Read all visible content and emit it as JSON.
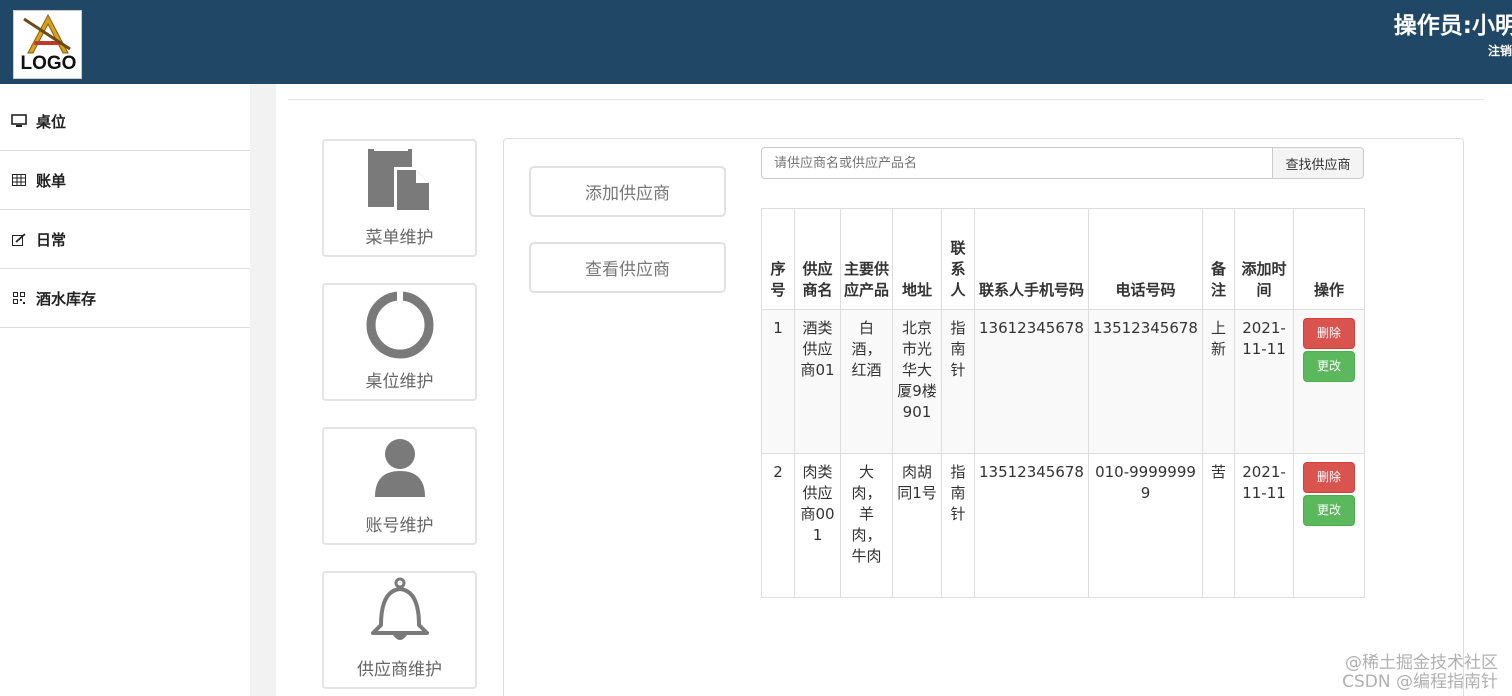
{
  "header": {
    "logo_text": "LOGO",
    "operator": "操作员:小明",
    "logout": "注销"
  },
  "sidebar": {
    "items": [
      {
        "label": "桌位",
        "icon": "monitor-icon"
      },
      {
        "label": "账单",
        "icon": "table-icon"
      },
      {
        "label": "日常",
        "icon": "edit-icon"
      },
      {
        "label": "酒水库存",
        "icon": "qrcode-icon"
      }
    ]
  },
  "tiles": [
    {
      "label": "菜单维护",
      "icon": "document-icon"
    },
    {
      "label": "桌位维护",
      "icon": "ring-icon"
    },
    {
      "label": "账号维护",
      "icon": "user-icon"
    },
    {
      "label": "供应商维护",
      "icon": "bell-icon"
    }
  ],
  "actions": {
    "add_supplier": "添加供应商",
    "view_supplier": "查看供应商"
  },
  "search": {
    "placeholder": "请供应商名或供应产品名",
    "button": "查找供应商"
  },
  "table": {
    "headers": [
      "序号",
      "供应商名",
      "主要供应产品",
      "地址",
      "联系人",
      "联系人手机号码",
      "电话号码",
      "备注",
      "添加时间",
      "操作"
    ],
    "rows": [
      {
        "no": "1",
        "name": "酒类供应商01",
        "products": "白酒，红酒",
        "address": "北京市光华大厦9楼901",
        "contact": "指南针",
        "mobile": "13612345678",
        "phone": "13512345678",
        "remark": "上新",
        "added": "2021-11-11"
      },
      {
        "no": "2",
        "name": "肉类供应商001",
        "products": "大肉，羊肉，牛肉",
        "address": "肉胡同1号",
        "contact": "指南针",
        "mobile": "13512345678",
        "phone": "010-99999999",
        "remark": "苦",
        "added": "2021-11-11"
      }
    ],
    "delete_label": "删除",
    "update_label": "更改"
  },
  "watermark": {
    "line1": "@稀土掘金技术社区",
    "line2": "CSDN @编程指南针"
  },
  "colors": {
    "header_bg": "#214766",
    "delete": "#d9534f",
    "update": "#5cb85c",
    "icon_gray": "#7a7a7a"
  }
}
